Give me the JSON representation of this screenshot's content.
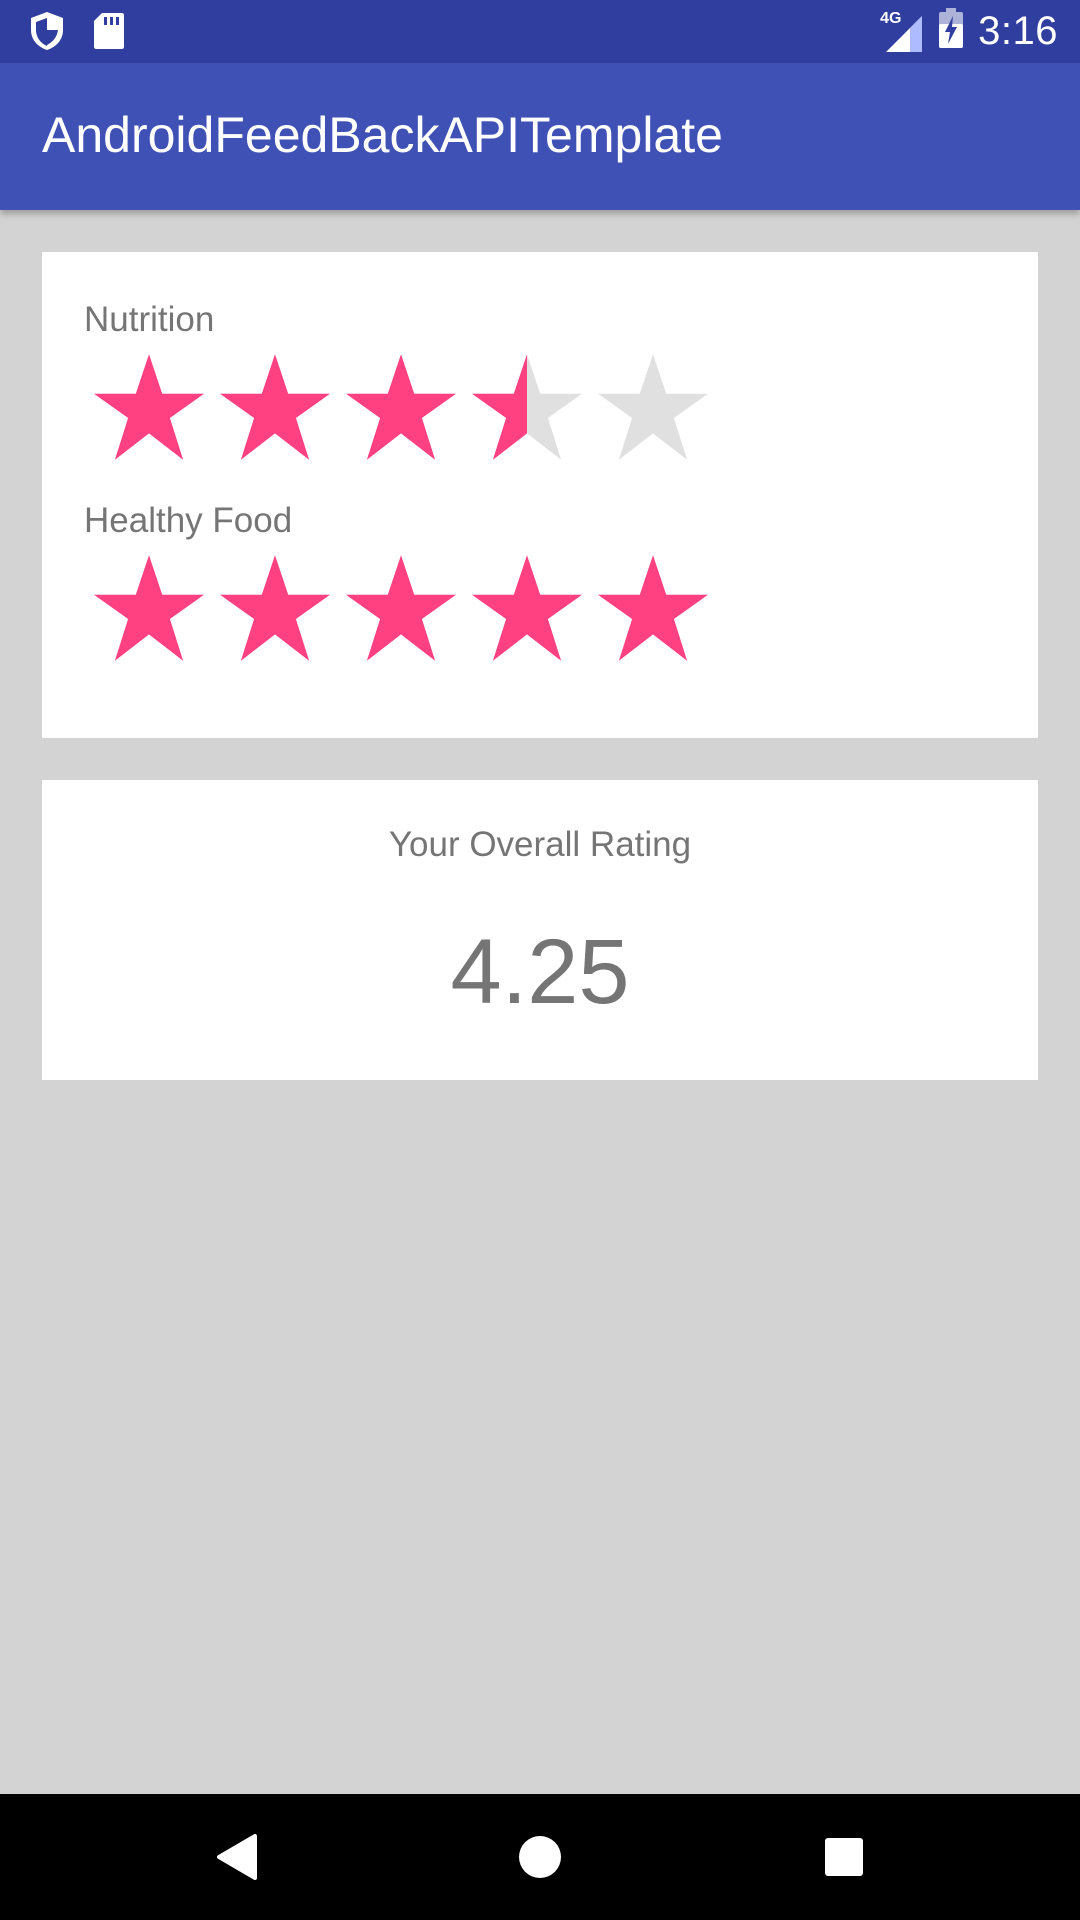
{
  "status_bar": {
    "time": "3:16",
    "network_label": "4G",
    "icons": [
      "shield-icon",
      "sd-card-icon",
      "signal-icon",
      "battery-charging-icon"
    ]
  },
  "app_bar": {
    "title": "AndroidFeedBackAPITemplate",
    "color": "#3f51b5"
  },
  "ratings": [
    {
      "label": "Nutrition",
      "value": 3.5,
      "max": 5
    },
    {
      "label": "Healthy Food",
      "value": 5,
      "max": 5
    }
  ],
  "overall": {
    "label": "Your Overall Rating",
    "value": "4.25"
  },
  "colors": {
    "star_filled": "#ff4081",
    "star_empty": "#e0e0e0",
    "status_bar": "#303f9f",
    "background": "#d3d3d3"
  },
  "nav_bar": {
    "icons": [
      "back-icon",
      "home-icon",
      "recents-icon"
    ]
  }
}
